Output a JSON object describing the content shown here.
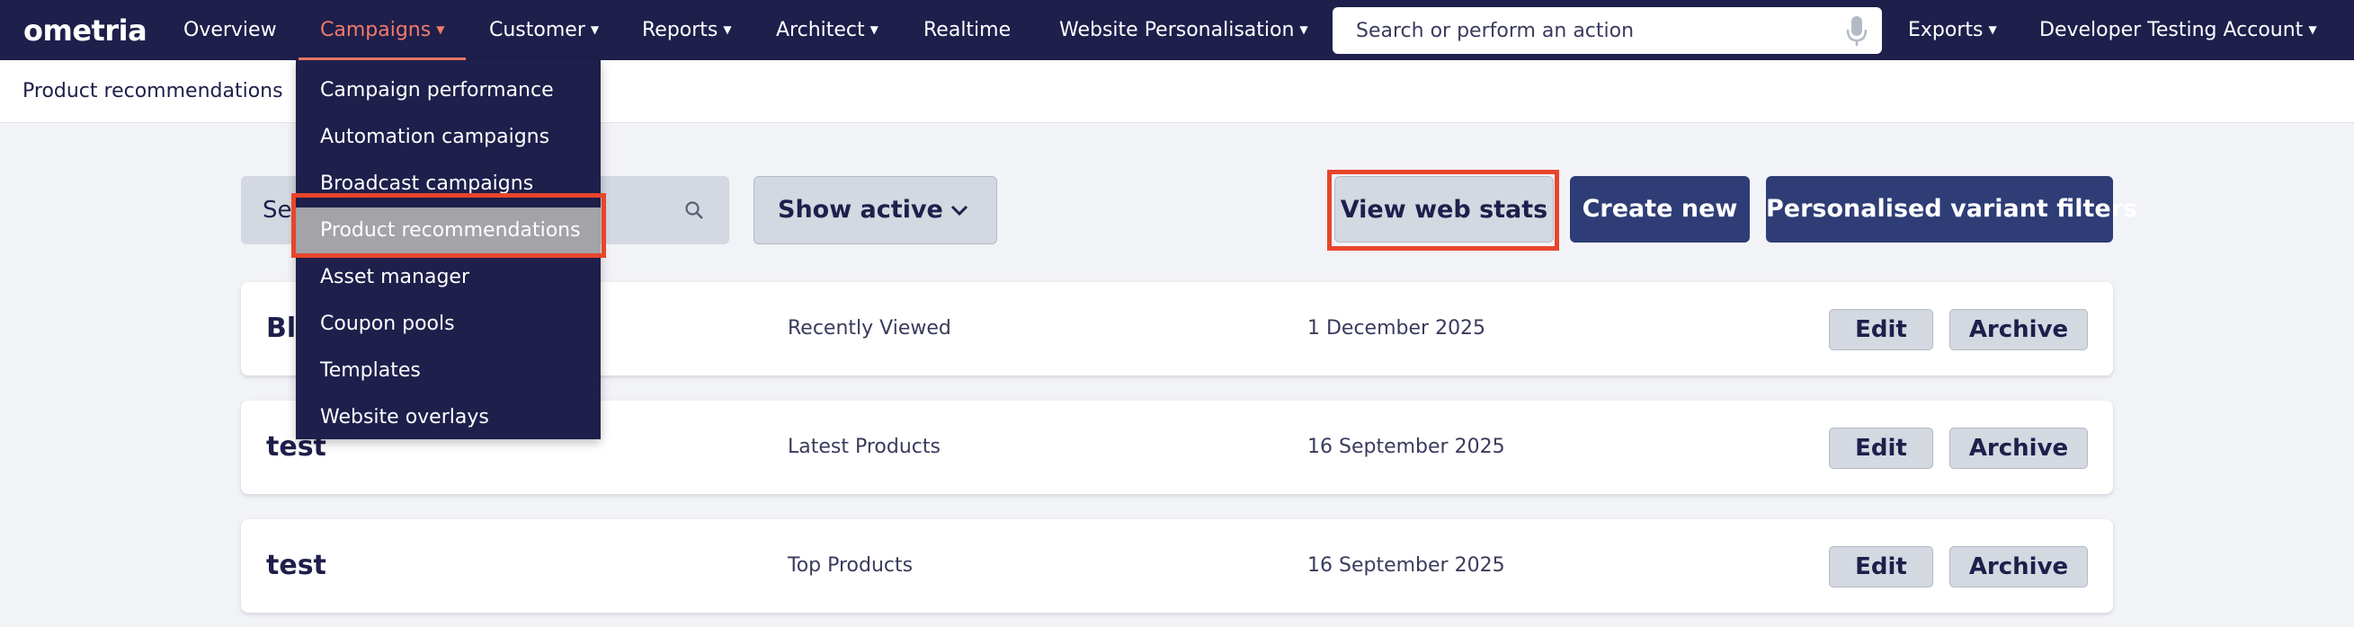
{
  "nav": {
    "logo": "ometria",
    "items": [
      {
        "label": "Overview",
        "caret": false
      },
      {
        "label": "Campaigns",
        "caret": true
      },
      {
        "label": "Customer",
        "caret": true
      },
      {
        "label": "Reports",
        "caret": true
      },
      {
        "label": "Architect",
        "caret": true
      },
      {
        "label": "Realtime",
        "caret": false
      },
      {
        "label": "Website Personalisation",
        "caret": true
      }
    ],
    "search_placeholder": "Search or perform an action",
    "exports": "Exports",
    "account": "Developer Testing Account",
    "active_color": "#f27a68",
    "bg_color": "#1e1f4b"
  },
  "subheader": {
    "title": "Product recommendations"
  },
  "campaigns_menu": {
    "items": [
      "Campaign performance",
      "Automation campaigns",
      "Broadcast campaigns",
      "Product recommendations",
      "Asset manager",
      "Coupon pools",
      "Templates",
      "Website overlays"
    ],
    "selected": "Product recommendations"
  },
  "toolbar": {
    "search_placeholder_visible": "Se",
    "filter_label": "Show active",
    "view_stats": "View web stats",
    "create_new": "Create new",
    "personalised_filters": "Personalised variant filters"
  },
  "recommendations": [
    {
      "name": "Bl",
      "type": "Recently Viewed",
      "date": "1 December 2025"
    },
    {
      "name": "test",
      "type": "Latest Products",
      "date": "16 September 2025"
    },
    {
      "name": "test",
      "type": "Top Products",
      "date": "16 September 2025"
    }
  ],
  "row_actions": {
    "edit": "Edit",
    "archive": "Archive"
  },
  "highlight_color": "#e8452a"
}
